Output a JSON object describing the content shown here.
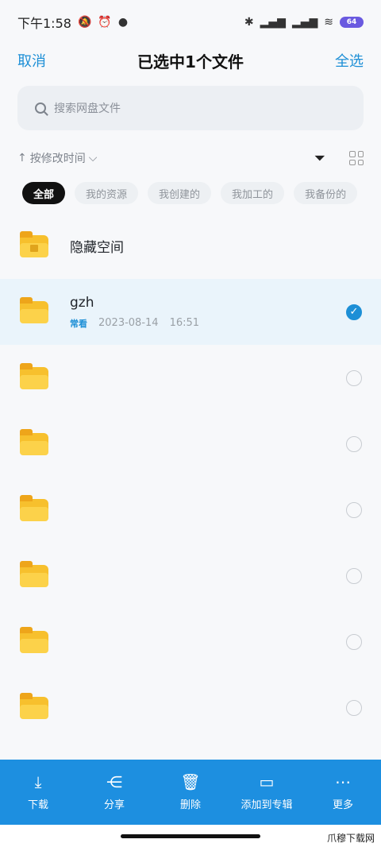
{
  "status_bar": {
    "time": "下午1:58",
    "battery": "64"
  },
  "header": {
    "cancel": "取消",
    "title": "已选中1个文件",
    "select_all": "全选"
  },
  "search": {
    "placeholder": "搜索网盘文件"
  },
  "sort": {
    "label": "按修改时间"
  },
  "chips": [
    "全部",
    "我的资源",
    "我创建的",
    "我加工的",
    "我备份的"
  ],
  "files": [
    {
      "name": "隐藏空间",
      "type": "hidden-folder",
      "selected": false
    },
    {
      "name": "gzh",
      "tag": "常看",
      "date": "2023-08-14",
      "time": "16:51",
      "selected": true
    },
    {
      "name": "",
      "selected": false
    },
    {
      "name": "",
      "selected": false
    },
    {
      "name": "",
      "selected": false
    },
    {
      "name": "",
      "selected": false
    },
    {
      "name": "",
      "selected": false
    },
    {
      "name": "",
      "selected": false
    }
  ],
  "toolbar": {
    "download": "下载",
    "share": "分享",
    "delete": "删除",
    "add_to_album": "添加到专辑",
    "more": "更多"
  },
  "watermark": "爪穆下载网",
  "colors": {
    "accent": "#1d8fd6",
    "toolbar_bg": "#1d8fe0",
    "folder": "#f7c02d"
  }
}
